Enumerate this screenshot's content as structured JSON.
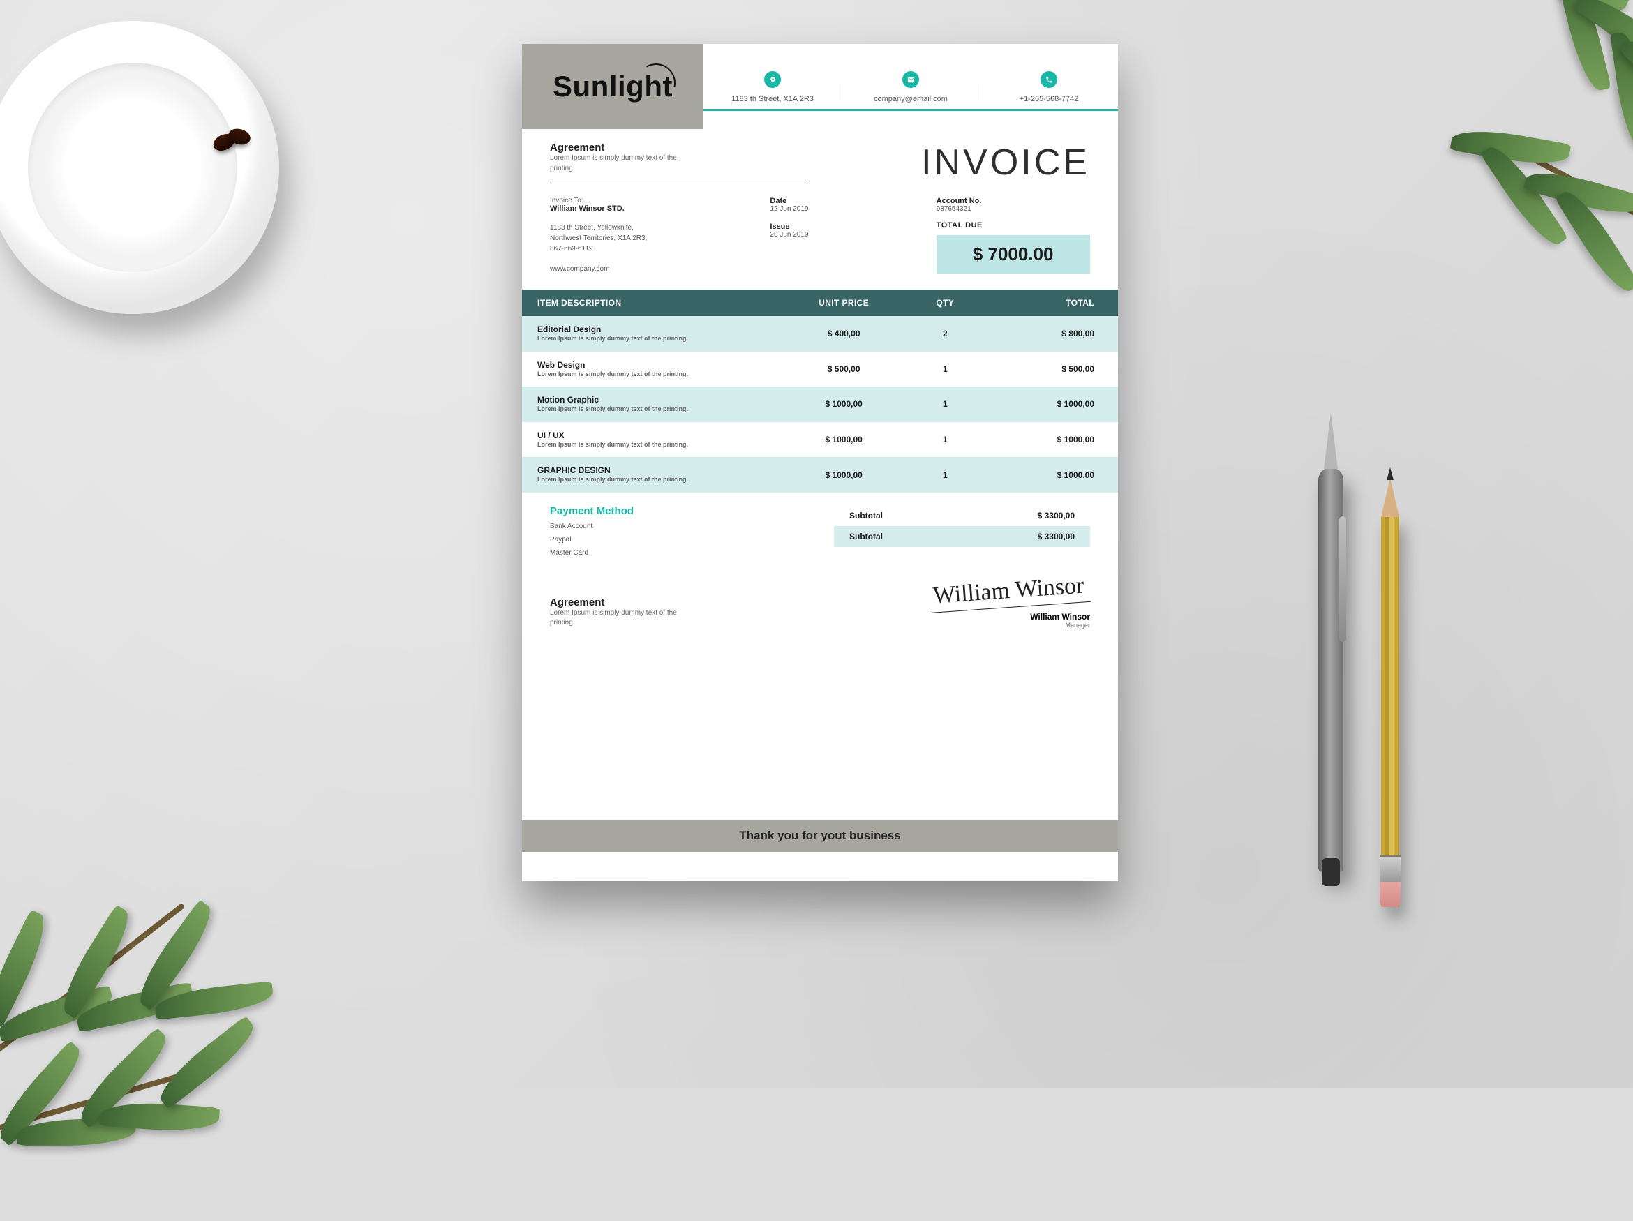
{
  "brand": {
    "name": "Sunlight"
  },
  "contacts": {
    "address": "1183  th Street,  X1A 2R3",
    "email": "company@email.com",
    "phone": "+1-265-568-7742"
  },
  "agreement": {
    "heading": "Agreement",
    "copy": "Lorem Ipsum is simply dummy text of the printing."
  },
  "invoice_title": "INVOICE",
  "invoice_to": {
    "label": "Invoice To:",
    "name": "William Winsor STD.",
    "addr_line1": "1183  th Street, Yellowknife,",
    "addr_line2": "Northwest Territories, X1A 2R3,",
    "addr_line3": "867-669-6119",
    "site": "www.company.com"
  },
  "dates": {
    "date_label": "Date",
    "date_value": "12 Jun 2019",
    "issue_label": "Issue",
    "issue_value": "20 Jun 2019"
  },
  "account": {
    "label": "Account No.",
    "value": "987654321"
  },
  "total_due": {
    "label": "TOTAL DUE",
    "value": "$ 7000.00"
  },
  "table": {
    "headers": {
      "desc": "ITEM DESCRIPTION",
      "unit": "UNIT PRICE",
      "qty": "QTY",
      "total": "TOTAL"
    },
    "rows": [
      {
        "title": "Editorial Design",
        "sub": "Lorem Ipsum is simply dummy text of the printing.",
        "unit": "$ 400,00",
        "qty": "2",
        "total": "$ 800,00"
      },
      {
        "title": "Web Design",
        "sub": "Lorem Ipsum is simply dummy text of the printing.",
        "unit": "$ 500,00",
        "qty": "1",
        "total": "$ 500,00"
      },
      {
        "title": "Motion Graphic",
        "sub": "Lorem Ipsum is simply dummy text of the printing.",
        "unit": "$ 1000,00",
        "qty": "1",
        "total": "$ 1000,00"
      },
      {
        "title": "UI / UX",
        "sub": "Lorem Ipsum is simply dummy text of the printing.",
        "unit": "$ 1000,00",
        "qty": "1",
        "total": "$ 1000,00"
      },
      {
        "title": "GRAPHIC DESIGN",
        "sub": "Lorem Ipsum is simply dummy text of the printing.",
        "unit": "$ 1000,00",
        "qty": "1",
        "total": "$ 1000,00"
      }
    ]
  },
  "payment": {
    "heading": "Payment Method",
    "methods": [
      "Bank Account",
      "Paypal",
      "Master Card"
    ]
  },
  "subtotals": [
    {
      "label": "Subtotal",
      "value": "$ 3300,00"
    },
    {
      "label": "Subtotal",
      "value": "$ 3300,00"
    }
  ],
  "agreement_bottom": {
    "heading": "Agreement",
    "copy": "Lorem Ipsum is simply dummy text of the printing."
  },
  "signature": {
    "script": "William Winsor",
    "name": "William Winsor",
    "role": "Manager"
  },
  "footer": "Thank you for yout business",
  "colors": {
    "accent": "#19b7a6",
    "header_dark": "#3a6566",
    "tint": "#d5ecec",
    "grey": "#a7a7a0"
  }
}
